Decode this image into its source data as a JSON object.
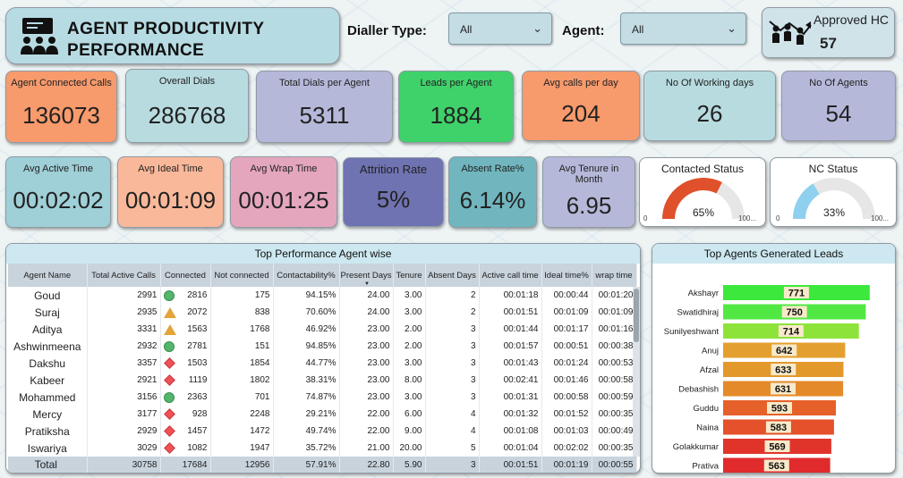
{
  "header": {
    "title_line1": "AGENT PRODUCTIVITY",
    "title_line2": "PERFORMANCE",
    "icon": "team-meeting-icon"
  },
  "filters": {
    "dialler_label": "Dialler Type:",
    "dialler_value": "All",
    "agent_label": "Agent:",
    "agent_value": "All"
  },
  "approved_hc": {
    "label": "Approved HC",
    "value": "57",
    "icon": "people-growth-icon"
  },
  "kpis_row1": [
    {
      "label": "Agent Connected Calls",
      "value": "136073",
      "color": "#f79a6c"
    },
    {
      "label": "Overall Dials",
      "value": "286768",
      "color": "#b8dbe0"
    },
    {
      "label": "Total Dials per Agent",
      "value": "5311",
      "color": "#b5b8d9"
    },
    {
      "label": "Leads per Agent",
      "value": "1884",
      "color": "#3fd16a"
    },
    {
      "label": "Avg calls per day",
      "value": "204",
      "color": "#f79a6c"
    },
    {
      "label": "No Of Working days",
      "value": "26",
      "color": "#b8dbe0"
    },
    {
      "label": "No Of Agents",
      "value": "54",
      "color": "#b5b8d9"
    }
  ],
  "kpis_row2": [
    {
      "label": "Avg Active Time",
      "value": "00:02:02",
      "color": "#9fcfd7"
    },
    {
      "label": "Avg Ideal Time",
      "value": "00:01:09",
      "color": "#f9b89a"
    },
    {
      "label": "Avg Wrap Time",
      "value": "00:01:25",
      "color": "#e4a6bd"
    },
    {
      "label": "Attrition Rate",
      "value": "5%",
      "color": "#6f73b1"
    },
    {
      "label": "Absent Rate%",
      "value": "6.14%",
      "color": "#71b6bf"
    },
    {
      "label": "Avg Tenure in Month",
      "value": "6.95",
      "color": "#b5b8d9"
    }
  ],
  "gauges": [
    {
      "title": "Contacted Status",
      "value": "65%",
      "min": "0",
      "max": "100...",
      "fraction": 0.65,
      "color": "#e0502a"
    },
    {
      "title": "NC Status",
      "value": "33%",
      "min": "0",
      "max": "100...",
      "fraction": 0.33,
      "color": "#8ed0ee"
    }
  ],
  "table": {
    "title": "Top Performance Agent wise",
    "columns": [
      "Agent Name",
      "Total Active Calls",
      "Connected",
      "Not connected",
      "Contactability%",
      "Present Days",
      "Tenure",
      "Absent Days",
      "Active call time",
      "Ideal time%",
      "wrap time"
    ],
    "sort_indicator": "▼",
    "rows": [
      {
        "name": "Goud",
        "total": "2991",
        "ind": "g",
        "connected": "2816",
        "notc": "175",
        "contact": "94.15%",
        "present": "24.00",
        "tenure": "3.00",
        "absent": "2",
        "active": "00:01:18",
        "ideal": "00:00:44",
        "wrap": "00:01:20"
      },
      {
        "name": "Suraj",
        "total": "2935",
        "ind": "y",
        "connected": "2072",
        "notc": "838",
        "contact": "70.60%",
        "present": "24.00",
        "tenure": "3.00",
        "absent": "2",
        "active": "00:01:51",
        "ideal": "00:01:09",
        "wrap": "00:01:09"
      },
      {
        "name": "Aditya",
        "total": "3331",
        "ind": "y",
        "connected": "1563",
        "notc": "1768",
        "contact": "46.92%",
        "present": "23.00",
        "tenure": "2.00",
        "absent": "3",
        "active": "00:01:44",
        "ideal": "00:01:17",
        "wrap": "00:01:16"
      },
      {
        "name": "Ashwinmeena",
        "total": "2932",
        "ind": "g",
        "connected": "2781",
        "notc": "151",
        "contact": "94.85%",
        "present": "23.00",
        "tenure": "2.00",
        "absent": "3",
        "active": "00:01:57",
        "ideal": "00:00:51",
        "wrap": "00:00:38"
      },
      {
        "name": "Dakshu",
        "total": "3357",
        "ind": "r",
        "connected": "1503",
        "notc": "1854",
        "contact": "44.77%",
        "present": "23.00",
        "tenure": "3.00",
        "absent": "3",
        "active": "00:01:43",
        "ideal": "00:01:24",
        "wrap": "00:00:53"
      },
      {
        "name": "Kabeer",
        "total": "2921",
        "ind": "r",
        "connected": "1119",
        "notc": "1802",
        "contact": "38.31%",
        "present": "23.00",
        "tenure": "8.00",
        "absent": "3",
        "active": "00:02:41",
        "ideal": "00:01:46",
        "wrap": "00:00:58"
      },
      {
        "name": "Mohammed",
        "total": "3156",
        "ind": "g",
        "connected": "2363",
        "notc": "701",
        "contact": "74.87%",
        "present": "23.00",
        "tenure": "3.00",
        "absent": "3",
        "active": "00:01:31",
        "ideal": "00:00:58",
        "wrap": "00:00:59"
      },
      {
        "name": "Mercy",
        "total": "3177",
        "ind": "r",
        "connected": "928",
        "notc": "2248",
        "contact": "29.21%",
        "present": "22.00",
        "tenure": "6.00",
        "absent": "4",
        "active": "00:01:32",
        "ideal": "00:01:52",
        "wrap": "00:00:35"
      },
      {
        "name": "Pratiksha",
        "total": "2929",
        "ind": "r",
        "connected": "1457",
        "notc": "1472",
        "contact": "49.74%",
        "present": "22.00",
        "tenure": "9.00",
        "absent": "4",
        "active": "00:01:08",
        "ideal": "00:01:03",
        "wrap": "00:00:49"
      },
      {
        "name": "Iswariya",
        "total": "3029",
        "ind": "r",
        "connected": "1082",
        "notc": "1947",
        "contact": "35.72%",
        "present": "21.00",
        "tenure": "20.00",
        "absent": "5",
        "active": "00:01:04",
        "ideal": "00:02:02",
        "wrap": "00:00:35"
      }
    ],
    "total": {
      "name": "Total",
      "total": "30758",
      "connected": "17684",
      "notc": "12956",
      "contact": "57.91%",
      "present": "22.80",
      "tenure": "5.90",
      "absent": "3",
      "active": "00:01:51",
      "ideal": "00:01:19",
      "wrap": "00:00:55"
    }
  },
  "chart_data": {
    "type": "bar",
    "orientation": "horizontal",
    "title": "Top Agents Generated Leads",
    "categories": [
      "Akshayr",
      "Swatidhiraj",
      "Sunilyeshwant",
      "Anuj",
      "Afzal",
      "Debashish",
      "Guddu",
      "Naina",
      "Golakkumar",
      "Prativa"
    ],
    "values": [
      771,
      750,
      714,
      642,
      633,
      631,
      593,
      583,
      569,
      563
    ],
    "colors": [
      "#3be83b",
      "#52e843",
      "#8ee33a",
      "#e4a02f",
      "#e3982c",
      "#e48a2a",
      "#e6602a",
      "#e5512a",
      "#e0342b",
      "#e02a2b"
    ],
    "xlim": [
      0,
      800
    ]
  }
}
